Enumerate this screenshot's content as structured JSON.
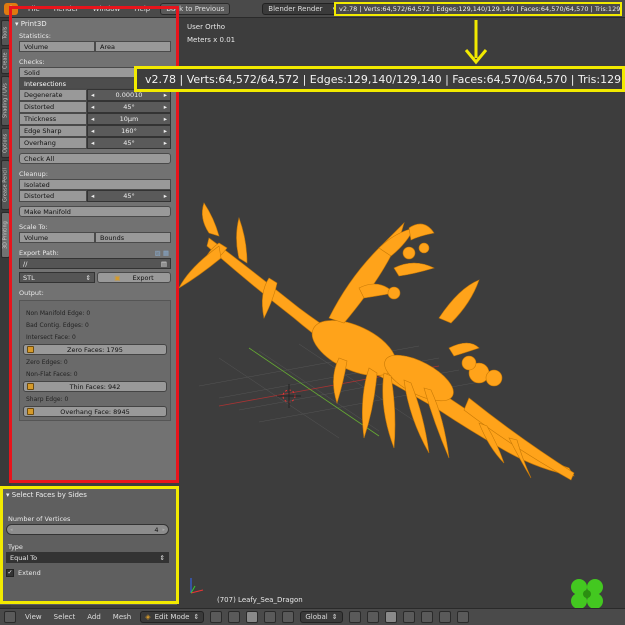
{
  "topbar": {
    "menus": [
      "File",
      "Render",
      "Window",
      "Help"
    ],
    "back_button": "Back to Previous",
    "render_engine": "Blender Render",
    "stats": "v2.78 | Verts:64,572/64,572 | Edges:129,140/129,140 | Faces:64,570/64,570 | Tris:129"
  },
  "tabs": [
    "Tools",
    "Create",
    "Shading / UVs",
    "Options",
    "Grease Pencil",
    "3D Printing"
  ],
  "print3d": {
    "title": "Print3D",
    "statistics_label": "Statistics:",
    "volume_btn": "Volume",
    "area_btn": "Area",
    "checks_label": "Checks:",
    "solid_btn": "Solid",
    "intersections_btn": "Intersections",
    "degenerate": {
      "name": "Degenerate",
      "value": "0.00010"
    },
    "distorted": {
      "name": "Distorted",
      "value": "45°"
    },
    "thickness": {
      "name": "Thickness",
      "value": "10μm"
    },
    "edge_sharp": {
      "name": "Edge Sharp",
      "value": "160°"
    },
    "overhang": {
      "name": "Overhang",
      "value": "45°"
    },
    "check_all": "Check All",
    "cleanup_label": "Cleanup:",
    "isolated_btn": "Isolated",
    "distorted2": {
      "name": "Distorted",
      "value": "45°"
    },
    "make_manifold": "Make Manifold",
    "scale_to_label": "Scale To:",
    "volume2_btn": "Volume",
    "bounds_btn": "Bounds",
    "export_path_label": "Export Path:",
    "export_path_value": "//",
    "format_value": "STL",
    "export_btn": "Export",
    "output_label": "Output:",
    "output": {
      "non_manifold": "Non Manifold Edge: 0",
      "bad_contig": "Bad Contig. Edges: 0",
      "intersect": "Intersect Face: 0",
      "zero_faces": "Zero Faces: 1795",
      "zero_edges": "Zero Edges: 0",
      "non_flat": "Non-Flat Faces: 0",
      "thin_faces": "Thin Faces: 942",
      "sharp_edge": "Sharp Edge: 0",
      "overhang_face": "Overhang Face: 8945"
    }
  },
  "operator": {
    "title": "Select Faces by Sides",
    "num_vertices_label": "Number of Vertices",
    "num_vertices_value": "4",
    "type_label": "Type",
    "type_value": "Equal To",
    "extend_label": "Extend"
  },
  "viewport": {
    "view_name": "User Ortho",
    "scale": "Meters x 0.01",
    "object_name": "(707) Leafy_Sea_Dragon",
    "big_stats": "v2.78 | Verts:64,572/64,572 | Edges:129,140/129,140 | Faces:64,570/64,570 | Tris:129,140"
  },
  "bottombar": {
    "menus": [
      "View",
      "Select",
      "Add",
      "Mesh"
    ],
    "mode": "Edit Mode",
    "orientation": "Global"
  },
  "colors": {
    "mesh": "#ffa31a",
    "highlight_red": "#e8141c",
    "highlight_yellow": "#f2ea00"
  }
}
